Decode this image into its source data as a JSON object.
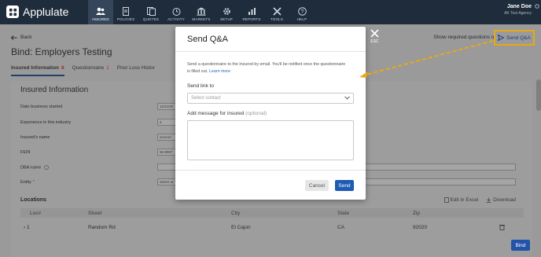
{
  "app": {
    "name": "Applulate"
  },
  "nav": [
    {
      "label": "INSURED",
      "icon": "users-icon",
      "active": true
    },
    {
      "label": "POLICIES",
      "icon": "document-icon",
      "active": false
    },
    {
      "label": "QUOTES",
      "icon": "quotes-icon",
      "active": false
    },
    {
      "label": "ACTIVITY",
      "icon": "activity-icon",
      "active": false
    },
    {
      "label": "MARKETS",
      "icon": "bank-icon",
      "active": false
    },
    {
      "label": "SETUP",
      "icon": "gear-icon",
      "active": false
    },
    {
      "label": "REPORTS",
      "icon": "chart-icon",
      "active": false
    },
    {
      "label": "TOOLS",
      "icon": "tools-icon",
      "active": false
    },
    {
      "label": "HELP",
      "icon": "help-icon",
      "active": false
    }
  ],
  "user": {
    "name": "Jane Doe",
    "agency": "AK Test Agency"
  },
  "page": {
    "back_label": "Back",
    "title": "Bind: Employers Testing",
    "show_required_label": "Show required questions on",
    "send_qa_label": "Send Q&A",
    "tabs": [
      {
        "label": "Insured Information",
        "count": "8"
      },
      {
        "label": "Questionnaire",
        "count": "1"
      },
      {
        "label": "Prior Loss Histor",
        "count": ""
      }
    ],
    "section_title": "Insured Information",
    "fields": [
      {
        "label": "Date business started",
        "value": "11/21/20",
        "required": false
      },
      {
        "label": "Experience in this industry",
        "value": "2",
        "required": false
      },
      {
        "label": "Insured's name",
        "value": "insured",
        "required": false
      },
      {
        "label": "FEIN",
        "value": "56-8957",
        "required": false
      },
      {
        "label": "DBA name",
        "value": "",
        "required": false
      },
      {
        "label": "Entity",
        "value": "Select or T",
        "required": true
      }
    ],
    "locations": {
      "title": "Locations",
      "edit_excel_label": "Edit in Excel",
      "download_label": "Download",
      "columns": [
        "Loc#",
        "Street",
        "City",
        "State",
        "Zip"
      ],
      "rows": [
        {
          "loc": "1",
          "street": "Random Rd",
          "city": "El Cajon",
          "state": "CA",
          "zip": "92020"
        }
      ]
    },
    "bind_label": "Bind"
  },
  "modal": {
    "title": "Send Q&A",
    "description": "Send a questionnaire to the Insured by email. You'll be notified once the questionnaire is filled out.",
    "learn_more": "Learn more",
    "send_link_label": "Send link to",
    "select_placeholder": "Select contact",
    "message_label": "Add message for insured",
    "message_optional": "(optional)",
    "cancel_label": "Cancel",
    "send_label": "Send",
    "esc_label": "ESC"
  },
  "colors": {
    "nav_bg": "#1f2c3b",
    "accent": "#1e5bb3",
    "highlight": "#e9a814"
  }
}
